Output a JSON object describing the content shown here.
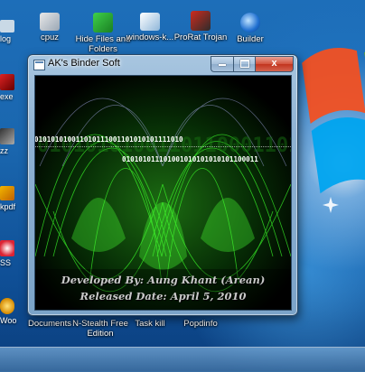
{
  "desktop": {
    "icons": [
      {
        "label": "cpuz"
      },
      {
        "label": "Hide Files and Folders"
      },
      {
        "label": "windows-k..."
      },
      {
        "label": "ProRat Trojan"
      },
      {
        "label": "Builder"
      },
      {
        "label": "Documents"
      },
      {
        "label": "N-Stealth Free Edition"
      },
      {
        "label": "Task kill"
      },
      {
        "label": "Popdinfo"
      }
    ],
    "edge_icons": [
      {
        "label": "log"
      },
      {
        "label": "exe"
      },
      {
        "label": "zz"
      },
      {
        "label": "kpdf"
      },
      {
        "label": "SS"
      },
      {
        "label": "Woo"
      }
    ]
  },
  "window": {
    "title": "AK's Binder Soft",
    "close_symbol": "x",
    "binary_line_1": "010101010011010111001101010101111010",
    "binary_line_2": "010101010011011000110110",
    "binary_line_3": "010101011101001010101010101100011",
    "credit_line_1": "Developed By: Aung Khant (Arean)",
    "credit_line_2": "Released Date:   April 5, 2010"
  },
  "colors": {
    "desktop_blue": "#1b6fb8",
    "art_green": "#34ff2a",
    "window_frame": "#8fb2d3",
    "close_red": "#c2341e"
  }
}
